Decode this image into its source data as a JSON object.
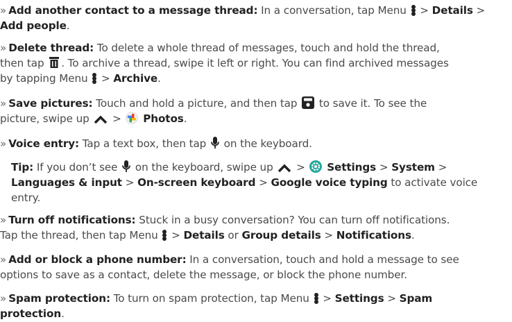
{
  "bullet": "»",
  "gt": ">",
  "items": {
    "add_contact": {
      "term": "Add another contact to a message thread:",
      "t1": "In a conversation, tap Menu",
      "b1": "Details",
      "b2": "Add people",
      "end": "."
    },
    "delete_thread": {
      "term": "Delete thread:",
      "t1": "To delete a whole thread of messages, touch and hold the thread,",
      "t2": "then tap",
      "t3": ". To archive a thread, swipe it left or right. You can find archived messages",
      "t4": "by tapping Menu",
      "b1": "Archive",
      "end": "."
    },
    "save_pictures": {
      "term": "Save pictures:",
      "t1": "Touch and hold a picture, and then tap",
      "t2": "to save it. To see the",
      "t3": "picture, swipe up",
      "b1": "Photos",
      "end": "."
    },
    "voice_entry": {
      "term": "Voice entry:",
      "t1": "Tap a text box, then tap",
      "t2": "on the keyboard."
    },
    "tip": {
      "term": "Tip:",
      "t1": "If you don’t see",
      "t2": "on the keyboard, swipe up",
      "b1": "Settings",
      "b2": "System",
      "b3": "Languages & input",
      "b4": "On-screen keyboard",
      "b5": "Google voice typing",
      "t3": "to activate voice",
      "t4": "entry."
    },
    "turn_off": {
      "term": "Turn off notifications:",
      "t1": "Stuck in a busy conversation? You can turn off notifications.",
      "t2": "Tap the thread, then tap Menu",
      "b1": "Details",
      "or": "or",
      "b2": "Group details",
      "b3": "Notifications",
      "end": "."
    },
    "block": {
      "term": "Add or block a phone number:",
      "t1": "In a conversation, touch and hold a message to see",
      "t2": "options to save as a contact, delete the message, or block the phone number."
    },
    "spam": {
      "term": "Spam protection:",
      "t1": "To turn on spam protection, tap Menu",
      "b1": "Settings",
      "b2": "Spam",
      "b3": "protection",
      "end": "."
    }
  }
}
